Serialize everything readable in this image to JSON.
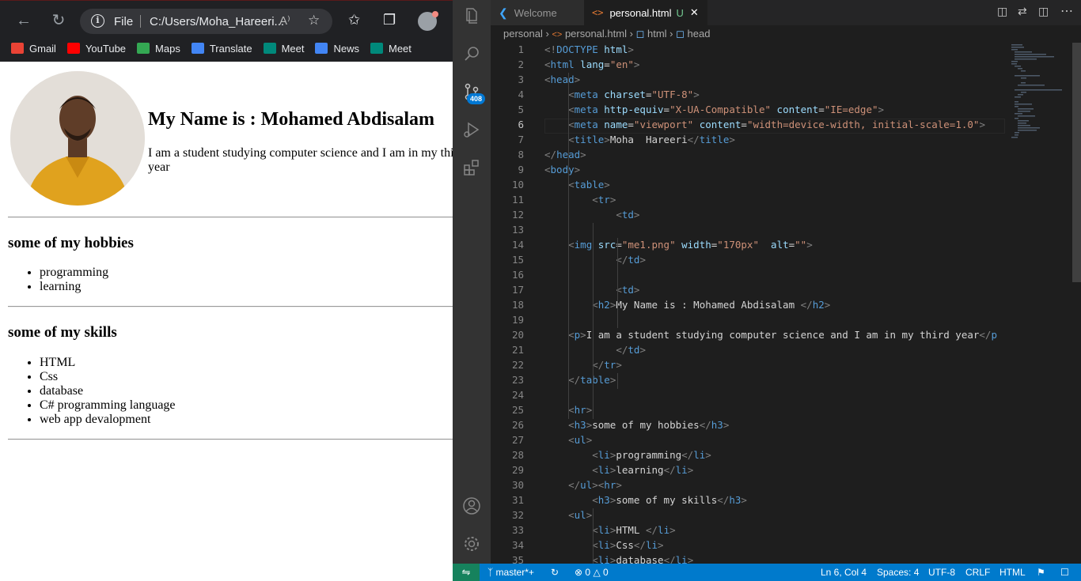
{
  "browser": {
    "address": {
      "scheme": "File",
      "url": "C:/Users/Moha_Hareeri..."
    },
    "bookmarks": [
      {
        "label": "Gmail",
        "color": "#ea4335"
      },
      {
        "label": "YouTube",
        "color": "#ff0000"
      },
      {
        "label": "Maps",
        "color": "#34a853"
      },
      {
        "label": "Translate",
        "color": "#4285f4"
      },
      {
        "label": "Meet",
        "color": "#00897b"
      },
      {
        "label": "News",
        "color": "#4285f4"
      },
      {
        "label": "Meet",
        "color": "#00897b"
      }
    ],
    "page": {
      "heading": "My Name is : Mohamed Abdisalam",
      "intro": "I am a student studying computer science and I am in my third year",
      "hobbies_title": "some of my hobbies",
      "hobbies": [
        "programming",
        "learning"
      ],
      "skills_title": "some of my skills",
      "skills": [
        "HTML",
        "Css",
        "database",
        "C# programming language",
        "web app devalopment"
      ]
    }
  },
  "vscode": {
    "tabs": [
      {
        "label": "Welcome"
      },
      {
        "label": "personal.html",
        "status": "U"
      }
    ],
    "breadcrumb": [
      "personal",
      "personal.html",
      "html",
      "head"
    ],
    "scm_badge": "408",
    "current_line": 6,
    "line_numbers": [
      "1",
      "2",
      "3",
      "4",
      "5",
      "6",
      "7",
      "8",
      "9",
      "10",
      "11",
      "12",
      "13",
      "14",
      "15",
      "16",
      "17",
      "18",
      "19",
      "20",
      "21",
      "22",
      "23",
      "24",
      "25",
      "26",
      "27",
      "28",
      "29",
      "30",
      "31",
      "32",
      "33",
      "34",
      "35"
    ],
    "code_lines": [
      "<!DOCTYPE html>",
      "<html lang=\"en\">",
      "<head>",
      "    <meta charset=\"UTF-8\">",
      "    <meta http-equiv=\"X-UA-Compatible\" content=\"IE=edge\">",
      "    <meta name=\"viewport\" content=\"width=device-width, initial-scale=1.0\">",
      "    <title>Moha  Hareeri</title>",
      "</head>",
      "<body>",
      "    <table>",
      "        <tr>",
      "            <td>",
      "",
      "    <img src=\"me1.png\" width=\"170px\"  alt=\"\">",
      "            </td>",
      "",
      "            <td>",
      "        <h2>My Name is : Mohamed Abdisalam </h2>",
      "",
      "    <p>I am a student studying computer science and I am in my third year</p",
      "            </td>",
      "        </tr>",
      "    </table>",
      "",
      "    <hr>",
      "    <h3>some of my hobbies</h3>",
      "    <ul>",
      "        <li>programming</li>",
      "        <li>learning</li>",
      "    </ul><hr>",
      "        <h3>some of my skills</h3>",
      "    <ul>",
      "        <li>HTML </li>",
      "        <li>Css</li>",
      "        <li>database</li>"
    ],
    "status": {
      "branch": "master*+",
      "errors": "0",
      "warnings": "0",
      "position": "Ln 6, Col 4",
      "spaces": "Spaces: 4",
      "encoding": "UTF-8",
      "eol": "CRLF",
      "language": "HTML"
    },
    "accent": "#007acc"
  }
}
